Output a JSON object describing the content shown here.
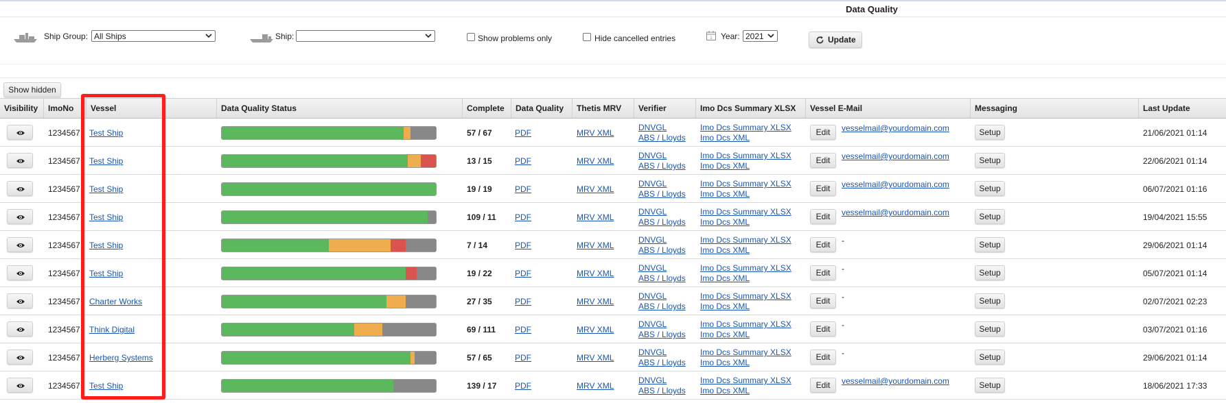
{
  "page": {
    "title": "Data Quality"
  },
  "filters": {
    "ship_group_label": "Ship Group:",
    "ship_group_value": "All Ships",
    "ship_label": "Ship:",
    "ship_value": "",
    "show_problems_label": "Show problems only",
    "hide_cancelled_label": "Hide cancelled entries",
    "year_label": "Year:",
    "year_value": "2021",
    "update_label": "Update"
  },
  "show_hidden_label": "Show hidden",
  "columns": [
    "Visibility",
    "ImoNo",
    "Vessel",
    "Data Quality Status",
    "Complete",
    "Data Quality",
    "Thetis MRV",
    "Verifier",
    "Imo Dcs Summary XLSX",
    "Vessel E-Mail",
    "Messaging",
    "Last Update"
  ],
  "colors": {
    "good": "#5cb85c",
    "warning": "#f0ad4e",
    "error": "#d9534f",
    "missing": "#888888",
    "highlight": "#ff1e1e",
    "link": "#1a56b0"
  },
  "rows": [
    {
      "imo": "1234567",
      "vessel": "Test Ship",
      "complete": "57 / 67",
      "pdf": "PDF",
      "mrv": "MRV XML",
      "verifier1": "DNVGL",
      "verifier2": "ABS / Lloyds",
      "imo_xlsx": "Imo Dcs Summary XLSX",
      "imo_xml": "Imo Dcs XML",
      "edit": "Edit",
      "email": "vesselmail@yourdomain.com",
      "setup": "Setup",
      "last_update": "21/06/2021 01:14",
      "quality": {
        "green": 0.85,
        "orange": 0.03,
        "red": 0.0,
        "gray": 0.12
      }
    },
    {
      "imo": "1234567",
      "vessel": "Test Ship",
      "complete": "13 / 15",
      "pdf": "PDF",
      "mrv": "MRV XML",
      "verifier1": "DNVGL",
      "verifier2": "ABS / Lloyds",
      "imo_xlsx": "Imo Dcs Summary XLSX",
      "imo_xml": "Imo Dcs XML",
      "edit": "Edit",
      "email": "vesselmail@yourdomain.com",
      "setup": "Setup",
      "last_update": "22/06/2021 01:14",
      "quality": {
        "green": 0.87,
        "orange": 0.06,
        "red": 0.07,
        "gray": 0.0
      }
    },
    {
      "imo": "1234567",
      "vessel": "Test Ship",
      "complete": "19 / 19",
      "pdf": "PDF",
      "mrv": "MRV XML",
      "verifier1": "DNVGL",
      "verifier2": "ABS / Lloyds",
      "imo_xlsx": "Imo Dcs Summary XLSX",
      "imo_xml": "Imo Dcs XML",
      "edit": "Edit",
      "email": "vesselmail@yourdomain.com",
      "setup": "Setup",
      "last_update": "06/07/2021 01:16",
      "quality": {
        "green": 1.0,
        "orange": 0.0,
        "red": 0.0,
        "gray": 0.0
      }
    },
    {
      "imo": "1234567",
      "vessel": "Test Ship",
      "complete": "109 / 11",
      "pdf": "PDF",
      "mrv": "MRV XML",
      "verifier1": "DNVGL",
      "verifier2": "ABS / Lloyds",
      "imo_xlsx": "Imo Dcs Summary XLSX",
      "imo_xml": "Imo Dcs XML",
      "edit": "Edit",
      "email": "vesselmail@yourdomain.com",
      "setup": "Setup",
      "last_update": "19/04/2021 15:55",
      "quality": {
        "green": 0.96,
        "orange": 0.0,
        "red": 0.0,
        "gray": 0.04
      }
    },
    {
      "imo": "1234567",
      "vessel": "Test Ship",
      "complete": "7 / 14",
      "pdf": "PDF",
      "mrv": "MRV XML",
      "verifier1": "DNVGL",
      "verifier2": "ABS / Lloyds",
      "imo_xlsx": "Imo Dcs Summary XLSX",
      "imo_xml": "Imo Dcs XML",
      "edit": "Edit",
      "email": "-",
      "setup": "Setup",
      "last_update": "29/06/2021 01:14",
      "quality": {
        "green": 0.5,
        "orange": 0.29,
        "red": 0.07,
        "gray": 0.14
      }
    },
    {
      "imo": "1234567",
      "vessel": "Test Ship",
      "complete": "19 / 22",
      "pdf": "PDF",
      "mrv": "MRV XML",
      "verifier1": "DNVGL",
      "verifier2": "ABS / Lloyds",
      "imo_xlsx": "Imo Dcs Summary XLSX",
      "imo_xml": "Imo Dcs XML",
      "edit": "Edit",
      "email": "-",
      "setup": "Setup",
      "last_update": "05/07/2021 01:14",
      "quality": {
        "green": 0.86,
        "orange": 0.0,
        "red": 0.05,
        "gray": 0.09
      }
    },
    {
      "imo": "1234567",
      "vessel": "Charter Works",
      "complete": "27 / 35",
      "pdf": "PDF",
      "mrv": "MRV XML",
      "verifier1": "DNVGL",
      "verifier2": "ABS / Lloyds",
      "imo_xlsx": "Imo Dcs Summary XLSX",
      "imo_xml": "Imo Dcs XML",
      "edit": "Edit",
      "email": "-",
      "setup": "Setup",
      "last_update": "02/07/2021 02:23",
      "quality": {
        "green": 0.77,
        "orange": 0.09,
        "red": 0.0,
        "gray": 0.14
      }
    },
    {
      "imo": "1234567",
      "vessel": "Think Digital",
      "complete": "69 / 111",
      "pdf": "PDF",
      "mrv": "MRV XML",
      "verifier1": "DNVGL",
      "verifier2": "ABS / Lloyds",
      "imo_xlsx": "Imo Dcs Summary XLSX",
      "imo_xml": "Imo Dcs XML",
      "edit": "Edit",
      "email": "-",
      "setup": "Setup",
      "last_update": "03/07/2021 01:16",
      "quality": {
        "green": 0.62,
        "orange": 0.13,
        "red": 0.0,
        "gray": 0.25
      }
    },
    {
      "imo": "1234567",
      "vessel": "Herberg Systems",
      "complete": "57 / 65",
      "pdf": "PDF",
      "mrv": "MRV XML",
      "verifier1": "DNVGL",
      "verifier2": "ABS / Lloyds",
      "imo_xlsx": "Imo Dcs Summary XLSX",
      "imo_xml": "Imo Dcs XML",
      "edit": "Edit",
      "email": "-",
      "setup": "Setup",
      "last_update": "29/06/2021 01:14",
      "quality": {
        "green": 0.88,
        "orange": 0.02,
        "red": 0.0,
        "gray": 0.1
      }
    },
    {
      "imo": "1234567",
      "vessel": "Test Ship",
      "complete": "139 / 17",
      "pdf": "PDF",
      "mrv": "MRV XML",
      "verifier1": "DNVGL",
      "verifier2": "ABS / Lloyds",
      "imo_xlsx": "Imo Dcs Summary XLSX",
      "imo_xml": "Imo Dcs XML",
      "edit": "Edit",
      "email": "vesselmail@yourdomain.com",
      "setup": "Setup",
      "last_update": "18/06/2021 17:33",
      "quality": {
        "green": 0.8,
        "orange": 0.0,
        "red": 0.0,
        "gray": 0.2
      }
    }
  ]
}
